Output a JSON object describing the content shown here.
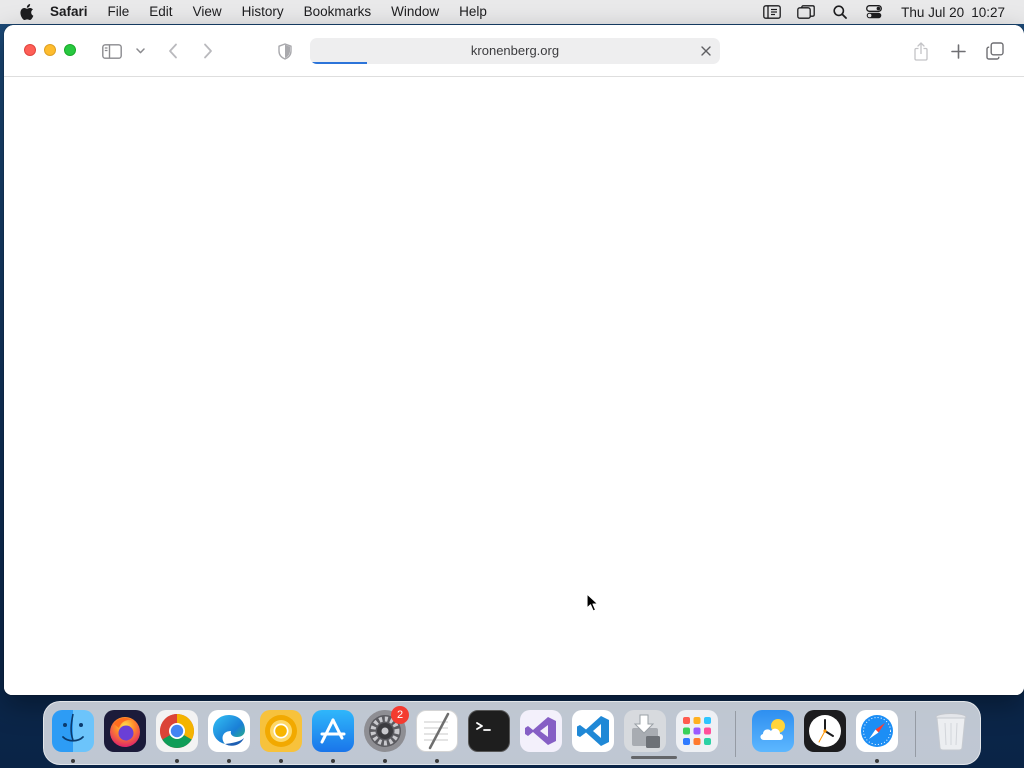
{
  "menubar": {
    "app_name": "Safari",
    "items": [
      "File",
      "Edit",
      "View",
      "History",
      "Bookmarks",
      "Window",
      "Help"
    ],
    "clock_day": "Thu Jul 20",
    "clock_time": "10:27"
  },
  "safari": {
    "url": "kronenberg.org",
    "load_progress": 0.14
  },
  "dock": {
    "apps": [
      {
        "name": "finder",
        "icon": "finder-icon",
        "running": true
      },
      {
        "name": "firefox",
        "icon": "firefox-icon",
        "running": false
      },
      {
        "name": "chrome",
        "icon": "chrome-icon",
        "running": true
      },
      {
        "name": "edge",
        "icon": "edge-icon",
        "running": true
      },
      {
        "name": "chrome-canary",
        "icon": "chrome-canary-icon",
        "running": true
      },
      {
        "name": "app-store",
        "icon": "app-store-icon",
        "running": true
      },
      {
        "name": "system-settings",
        "icon": "settings-gear-icon",
        "running": true,
        "badge": "2"
      },
      {
        "name": "textedit",
        "icon": "textedit-icon",
        "running": true
      },
      {
        "name": "terminal",
        "icon": "terminal-icon",
        "running": false
      },
      {
        "name": "visual-studio",
        "icon": "visual-studio-icon",
        "running": false
      },
      {
        "name": "vscode",
        "icon": "vscode-icon",
        "running": false
      },
      {
        "name": "installer",
        "icon": "installer-icon",
        "running": false
      },
      {
        "name": "launchpad",
        "icon": "launchpad-icon",
        "running": false
      },
      {
        "name": "weather",
        "icon": "weather-icon",
        "running": false
      },
      {
        "name": "clock",
        "icon": "clock-icon",
        "running": false
      },
      {
        "name": "safari",
        "icon": "safari-compass-icon",
        "running": true
      },
      {
        "name": "trash",
        "icon": "trash-icon",
        "running": false
      }
    ]
  },
  "colors": {
    "accent": "#2c74d9",
    "close": "#fe5f57",
    "minimize": "#febc2e",
    "zoom": "#28c840"
  }
}
